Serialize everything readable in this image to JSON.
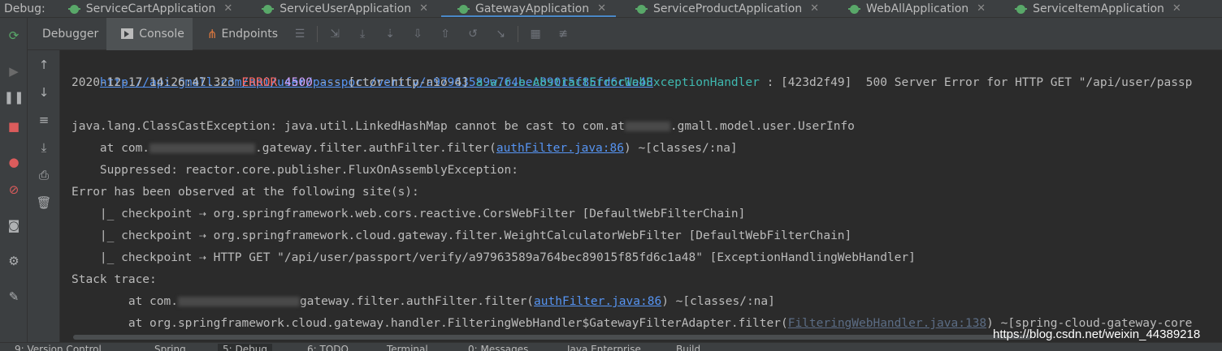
{
  "toolwindow": {
    "label": "Debug:"
  },
  "run_tabs": [
    {
      "label": "ServiceCartApplication"
    },
    {
      "label": "ServiceUserApplication"
    },
    {
      "label": "GatewayApplication"
    },
    {
      "label": "ServiceProductApplication"
    },
    {
      "label": "WebAllApplication"
    },
    {
      "label": "ServiceItemApplication"
    }
  ],
  "active_run_tab": "GatewayApplication",
  "subtabs": [
    {
      "label": "Debugger"
    },
    {
      "label": "Console"
    },
    {
      "label": "Endpoints"
    }
  ],
  "active_subtab": "Console",
  "console": {
    "url": "http://api.gmall.com/api/user/passport/verify/a97963589a764bec89015f85fd6c1a48",
    "log": {
      "timestamp": "2020-12-17 14:26:47.323",
      "level": "ERROR",
      "pid": "4500",
      "dashes": "---",
      "thread": "[ctor-http-nio-4]",
      "logger": "a.w.r.e.AbstractErrorWebExceptionHandler",
      "rest": ": [423d2f49]  500 Server Error for HTTP GET \"/api/user/passp"
    },
    "exception_prefix": "java.lang.ClassCastException: java.util.LinkedHashMap cannot be cast to com.at",
    "exception_suffix": ".gmall.model.user.UserInfo",
    "at1_prefix": "    at com.",
    "at1_mid": ".gateway.filter.authFilter.filter(",
    "at1_link": "authFilter.java:86",
    "at1_suffix": ") ~[classes/:na]",
    "suppressed": "    Suppressed: reactor.core.publisher.FluxOnAssemblyException:",
    "observed": "Error has been observed at the following site(s):",
    "checkpoints": [
      "    |_ checkpoint ⇢ org.springframework.web.cors.reactive.CorsWebFilter [DefaultWebFilterChain]",
      "    |_ checkpoint ⇢ org.springframework.cloud.gateway.filter.WeightCalculatorWebFilter [DefaultWebFilterChain]",
      "    |_ checkpoint ⇢ HTTP GET \"/api/user/passport/verify/a97963589a764bec89015f85fd6c1a48\" [ExceptionHandlingWebHandler]"
    ],
    "stack_trace": "Stack trace:",
    "st1_prefix": "        at com.",
    "st1_mid": "gateway.filter.authFilter.filter(",
    "st1_link": "authFilter.java:86",
    "st1_suffix": ") ~[classes/:na]",
    "st2_prefix": "        at org.springframework.cloud.gateway.handler.FilteringWebHandler$GatewayFilterAdapter.filter(",
    "st2_link": "FilteringWebHandler.java:138",
    "st2_suffix": ") ~[spring-cloud-gateway-core"
  },
  "bottom_tabs": [
    {
      "label": "9: Version Control"
    },
    {
      "label": "Spring"
    },
    {
      "label": "5: Debug"
    },
    {
      "label": "6: TODO"
    },
    {
      "label": "Terminal"
    },
    {
      "label": "0: Messages"
    },
    {
      "label": "Java Enterprise"
    },
    {
      "label": "Build"
    }
  ],
  "watermark": "https://blog.csdn.net/weixin_44389218",
  "colors": {
    "background": "#2b2b2b",
    "panel": "#3c3f41",
    "link": "#5694f2",
    "error": "#ff6b68",
    "pid": "#d0a3ff",
    "logger": "#3fb8af",
    "debug_icon": "#59a869"
  }
}
